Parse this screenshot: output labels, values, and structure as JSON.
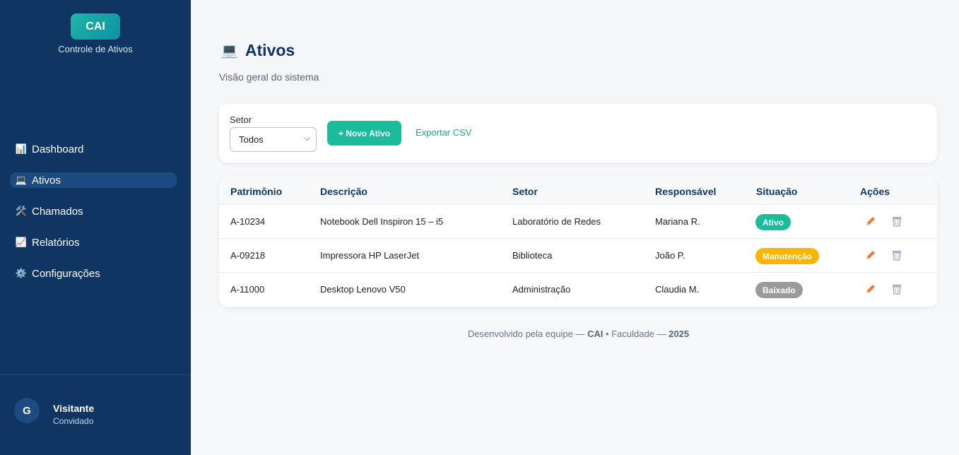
{
  "sidebar": {
    "logo": "CAI",
    "logo_sub": "Controle de Ativos",
    "items": [
      {
        "label": "Dashboard",
        "icon": "📊"
      },
      {
        "label": "Ativos",
        "icon": "💻"
      },
      {
        "label": "Chamados",
        "icon": "🛠️"
      },
      {
        "label": "Relatórios",
        "icon": "📈"
      },
      {
        "label": "Configurações",
        "icon": "⚙️"
      }
    ],
    "user": {
      "initial": "G",
      "name": "Visitante",
      "role": "Convidado"
    }
  },
  "page": {
    "icon": "💻",
    "title": "Ativos",
    "subtitle": "Visão geral do sistema"
  },
  "toolbar": {
    "setor_label": "Setor",
    "setor_value": "Todos",
    "new_button": "+ Novo Ativo",
    "export_link": "Exportar CSV"
  },
  "table": {
    "headers": [
      "Patrimônio",
      "Descrição",
      "Setor",
      "Responsável",
      "Situação",
      "Ações"
    ],
    "rows": [
      {
        "patrimonio": "A-10234",
        "descricao": "Notebook Dell Inspiron 15 – i5",
        "setor": "Laboratório de Redes",
        "responsavel": "Mariana R.",
        "situacao": "Ativo"
      },
      {
        "patrimonio": "A-09218",
        "descricao": "Impressora HP LaserJet",
        "setor": "Biblioteca",
        "responsavel": "João P.",
        "situacao": "Manutenção"
      },
      {
        "patrimonio": "A-11000",
        "descricao": "Desktop Lenovo V50",
        "setor": "Administração",
        "responsavel": "Claudia M.",
        "situacao": "Baixado"
      }
    ]
  },
  "status_colors": {
    "Ativo": "#1abc9c",
    "Manutenção": "#f7b500",
    "Baixado": "#9a9a9a"
  },
  "footer": {
    "prefix": "Desenvolvido pela equipe — ",
    "brand": "CAI",
    "middle": " • Faculdade — ",
    "year": "2025"
  }
}
